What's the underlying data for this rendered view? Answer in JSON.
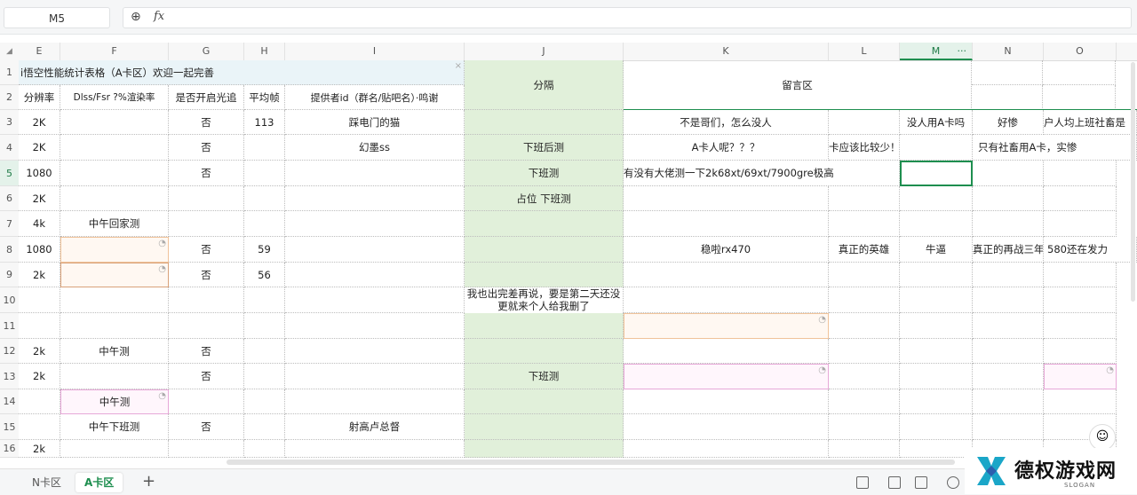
{
  "formula_bar": {
    "cell_ref": "M5",
    "zoom_glyph": "⊕",
    "fx_label": "fx"
  },
  "columns": [
    "E",
    "F",
    "G",
    "H",
    "I",
    "J",
    "K",
    "L",
    "M",
    "N",
    "O"
  ],
  "selected_col_extra": "···",
  "rows": [
    "1",
    "2",
    "3",
    "4",
    "5",
    "6",
    "7",
    "8",
    "9",
    "10",
    "11",
    "12",
    "13",
    "14",
    "15",
    "16"
  ],
  "cells": {
    "title": "i悟空性能统计表格（A卡区）欢迎一起完善",
    "h_e": "分辨率",
    "h_f": "Dlss/Fsr ?%渲染率",
    "h_g": "是否开启光追",
    "h_h": "平均帧",
    "h_i": "提供者id（群名/贴吧名）·鸣谢",
    "h_j": "分隔",
    "h_k": "留言区",
    "r3_e": "2K",
    "r3_g": "否",
    "r3_h": "113",
    "r3_i": "踩电门的猫",
    "r3_k": "不是哥们，怎么没人",
    "r3_m": "没人用A卡吗",
    "r3_n": "好惨",
    "r3_o": "户人均上班社畜是",
    "r4_e": "2K",
    "r4_g": "否",
    "r4_i": "幻墨ss",
    "r4_j": "下班后测",
    "r4_k": "A卡人呢？？？",
    "r4_l": "卡应该比较少！",
    "r4_n": "只有社畜用A卡，实惨",
    "r5_e": "1080",
    "r5_g": "否",
    "r5_j": "下班测",
    "r5_k": "有没有大佬测一下2k68xt/69xt/7900gre极高",
    "r6_e": "2K",
    "r6_j": "占位 下班测",
    "r7_e": "4k",
    "r7_f": "中午回家测",
    "r8_e": "1080",
    "r8_g": "否",
    "r8_h": "59",
    "r8_k": "稳啦rx470",
    "r8_l": "真正的英雄",
    "r8_m": "牛逼",
    "r8_n": "真正的再战三年",
    "r8_o": "580还在发力",
    "r9_e": "2k",
    "r9_g": "否",
    "r9_h": "56",
    "r10_j": "我也出完差再说，要是第二天还没更就来个人给我删了",
    "r12_e": "2k",
    "r12_f": "中午测",
    "r12_g": "否",
    "r13_e": "2k",
    "r13_g": "否",
    "r13_j": "下班测",
    "r14_f": "中午测",
    "r15_f": "中午下班测",
    "r15_g": "否",
    "r15_i": "射高卢总督",
    "r16_e": "2k"
  },
  "sheet_tabs": [
    "N卡区",
    "A卡区"
  ],
  "active_tab": "A卡区",
  "add_sheet": "+",
  "assistant_glyph": "☺",
  "watermark": {
    "text": "德权游戏网",
    "sub": "SLOGAN",
    "accent": "#1aa6c8",
    "accent2": "#2b5fae"
  },
  "colors": {
    "selection": "#1e8e4f",
    "separator_fill": "#e1f0da",
    "title_fill": "#eaf4f8"
  }
}
